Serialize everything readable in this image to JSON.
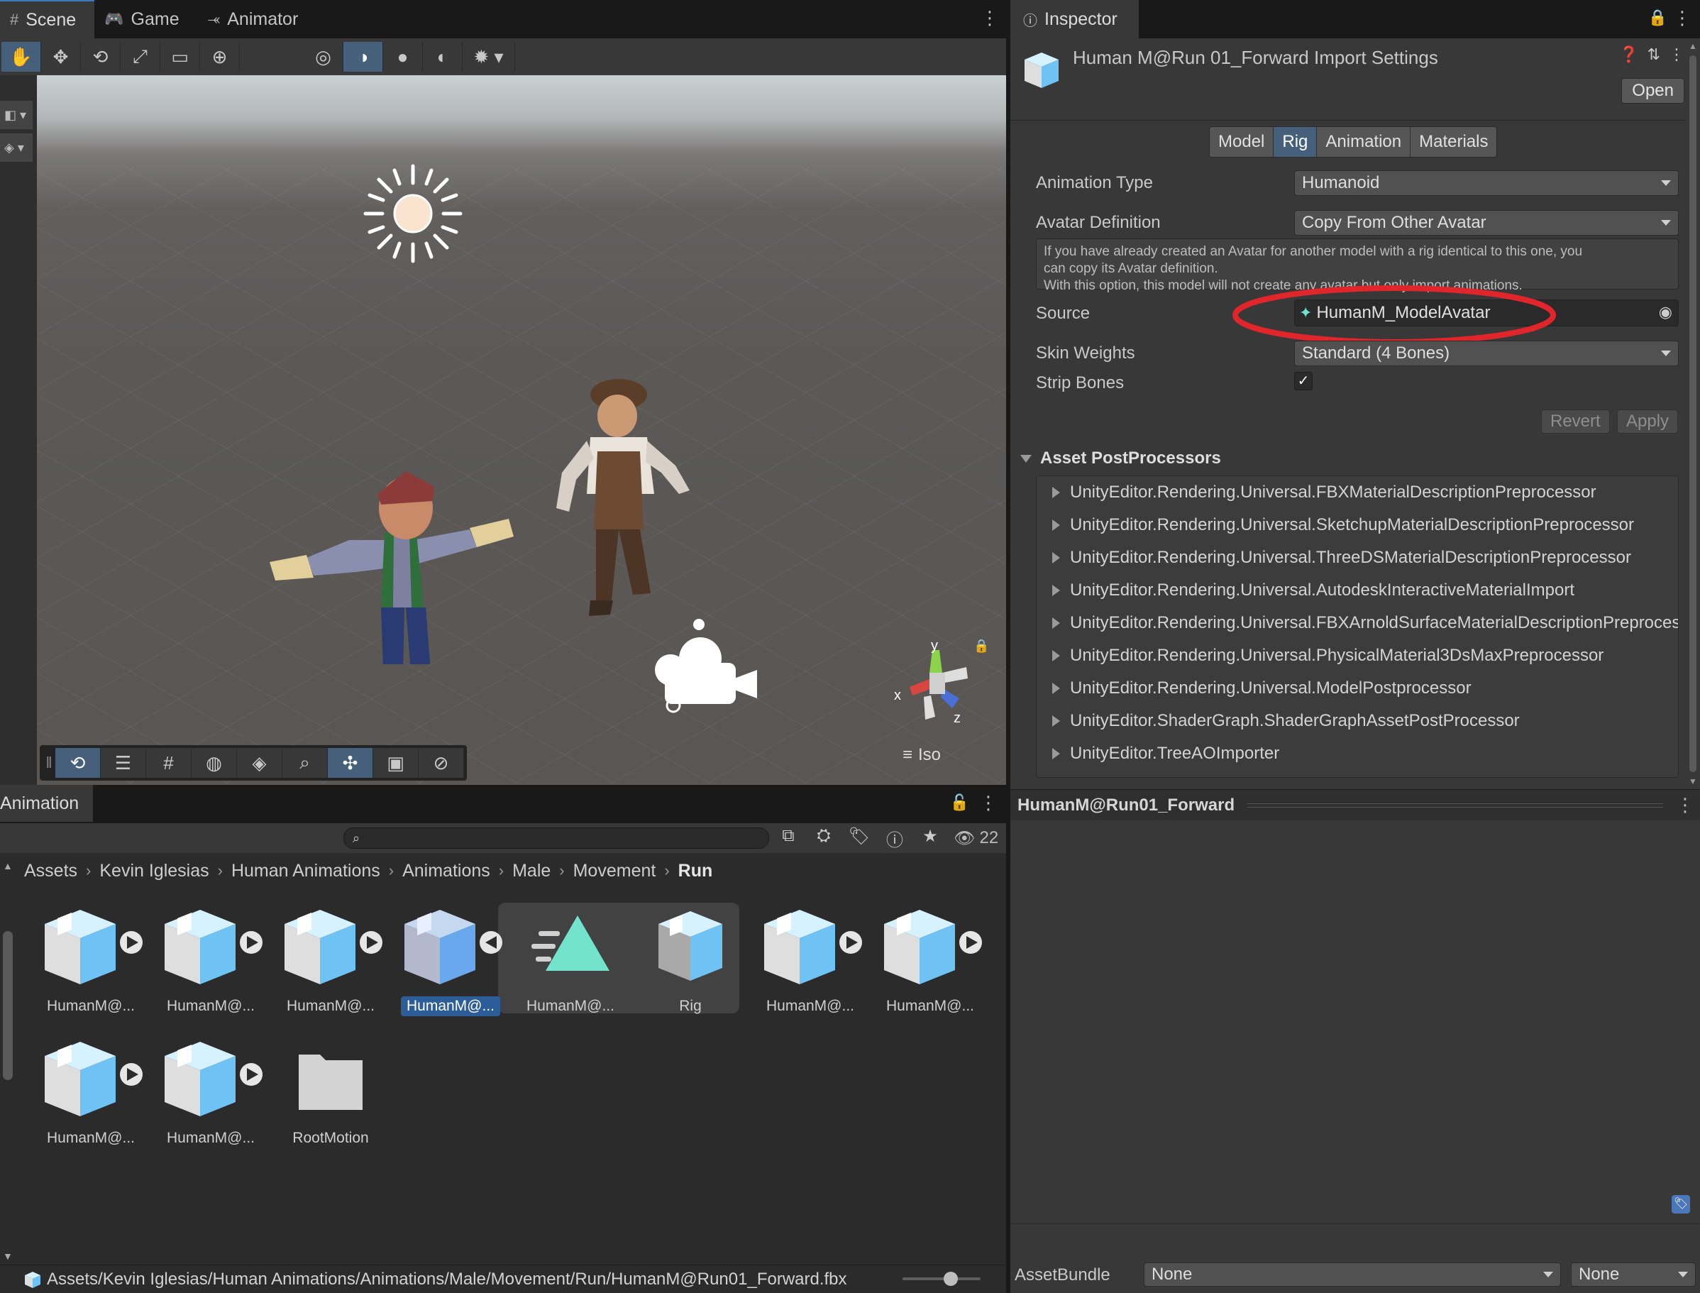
{
  "scene_tabs": [
    {
      "label": "Scene",
      "icon": "hash-icon"
    },
    {
      "label": "Game",
      "icon": "gamepad-icon"
    },
    {
      "label": "Animator",
      "icon": "animator-icon"
    }
  ],
  "scene_view": {
    "iso_label": "Iso",
    "gizmo": {
      "x": "x",
      "y": "y",
      "z": "z"
    }
  },
  "inspector": {
    "tab_label": "Inspector",
    "title": "Human M@Run 01_Forward Import Settings",
    "open_button": "Open",
    "segments": [
      "Model",
      "Rig",
      "Animation",
      "Materials"
    ],
    "active_segment": "Rig",
    "animation_type_label": "Animation Type",
    "animation_type_value": "Humanoid",
    "avatar_definition_label": "Avatar Definition",
    "avatar_definition_value": "Copy From Other Avatar",
    "help_line1": "If you have already created an Avatar for another model with a rig identical to this one, you",
    "help_line2": "can copy its Avatar definition.",
    "help_line3": "With this option, this model will not create any avatar but only import animations.",
    "source_label": "Source",
    "source_value": "HumanM_ModelAvatar",
    "skin_weights_label": "Skin Weights",
    "skin_weights_value": "Standard (4 Bones)",
    "strip_bones_label": "Strip Bones",
    "strip_bones_checked": true,
    "revert_button": "Revert",
    "apply_button": "Apply",
    "postprocessors_header": "Asset PostProcessors",
    "postprocessors": [
      "UnityEditor.Rendering.Universal.FBXMaterialDescriptionPreprocessor",
      "UnityEditor.Rendering.Universal.SketchupMaterialDescriptionPreprocessor",
      "UnityEditor.Rendering.Universal.ThreeDSMaterialDescriptionPreprocessor",
      "UnityEditor.Rendering.Universal.AutodeskInteractiveMaterialImport",
      "UnityEditor.Rendering.Universal.FBXArnoldSurfaceMaterialDescriptionPreprocessor",
      "UnityEditor.Rendering.Universal.PhysicalMaterial3DsMaxPreprocessor",
      "UnityEditor.Rendering.Universal.ModelPostprocessor",
      "UnityEditor.ShaderGraph.ShaderGraphAssetPostProcessor",
      "UnityEditor.TreeAOImporter"
    ],
    "preview_title": "HumanM@Run01_Forward",
    "assetbundle_label": "AssetBundle",
    "assetbundle_value": "None",
    "assetbundle_variant": "None",
    "highlight_color": "#e0262a"
  },
  "project": {
    "tab_label": "Animation",
    "search_placeholder": "",
    "hidden_count": "22",
    "breadcrumb": [
      "Assets",
      "Kevin Iglesias",
      "Human Animations",
      "Animations",
      "Male",
      "Movement",
      "Run"
    ],
    "assets_row1": [
      {
        "label": "HumanM@...",
        "kind": "model",
        "selected": false
      },
      {
        "label": "HumanM@...",
        "kind": "model",
        "selected": false
      },
      {
        "label": "HumanM@...",
        "kind": "model",
        "selected": false
      },
      {
        "label": "HumanM@...",
        "kind": "model-expanded",
        "selected": true
      },
      {
        "label": "HumanM@...",
        "kind": "clip",
        "selected": false
      },
      {
        "label": "Rig",
        "kind": "avatar",
        "selected": false
      },
      {
        "label": "HumanM@...",
        "kind": "model",
        "selected": false
      },
      {
        "label": "HumanM@...",
        "kind": "model",
        "selected": false
      }
    ],
    "assets_row2": [
      {
        "label": "HumanM@...",
        "kind": "model"
      },
      {
        "label": "HumanM@...",
        "kind": "model"
      },
      {
        "label": "RootMotion",
        "kind": "folder"
      }
    ],
    "status_path": "Assets/Kevin Iglesias/Human Animations/Animations/Male/Movement/Run/HumanM@Run01_Forward.fbx",
    "zoom_level": 0.6
  },
  "colors": {
    "accent": "#46607c",
    "selection": "#2d5d99",
    "model_icon_blue": "#6ec3f4",
    "clip_icon_teal": "#73e3cc"
  }
}
